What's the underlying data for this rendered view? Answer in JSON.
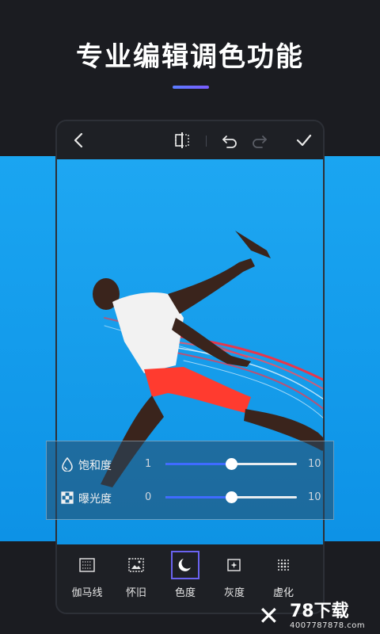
{
  "headline": {
    "title": "专业编辑调色功能"
  },
  "topbar": {
    "icons": [
      "back-arrow-icon",
      "compare-icon",
      "undo-icon",
      "redo-icon",
      "confirm-check-icon"
    ]
  },
  "adjustments": [
    {
      "label": "饱和度",
      "icon": "droplet-icon",
      "min": "1",
      "max": "10",
      "level": 0.5
    },
    {
      "label": "曝光度",
      "icon": "exposure-icon",
      "min": "0",
      "max": "10",
      "level": 0.5
    }
  ],
  "tools": [
    {
      "label": "伽马线",
      "icon": "gamma-icon",
      "active": false
    },
    {
      "label": "怀旧",
      "icon": "vintage-icon",
      "active": false
    },
    {
      "label": "色度",
      "icon": "moon-icon",
      "active": true
    },
    {
      "label": "灰度",
      "icon": "grayscale-icon",
      "active": false
    },
    {
      "label": "虚化",
      "icon": "blur-icon",
      "active": false
    }
  ],
  "watermark": {
    "title": "78下载",
    "subtitle": "4007787878.com"
  },
  "colors": {
    "accent": "#6a63f0",
    "slider_fill": "#3f6bff",
    "photo_bg": "#1ea7f2",
    "app_bg": "#1b1c21"
  }
}
